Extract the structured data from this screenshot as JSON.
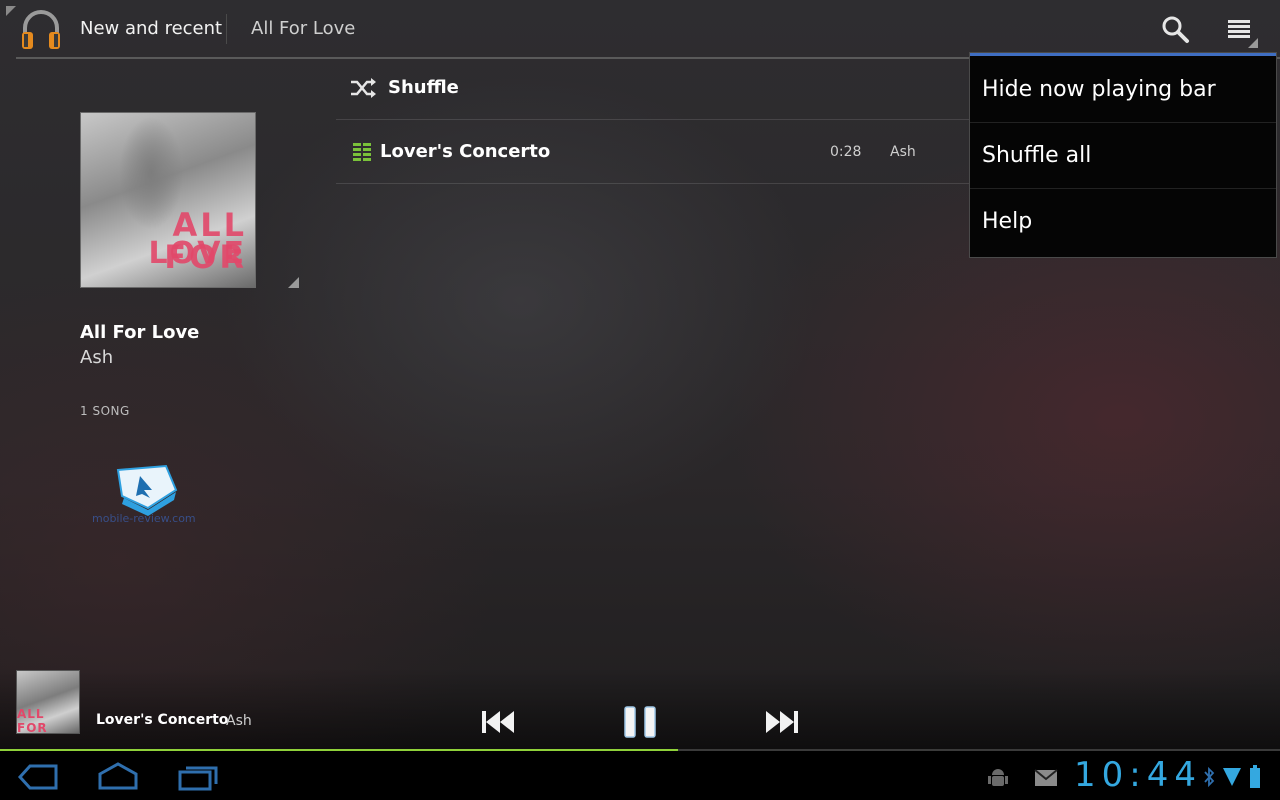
{
  "action_bar": {
    "tab_new_recent": "New and recent",
    "tab_album": "All For Love"
  },
  "album": {
    "title": "All For Love",
    "artist": "Ash",
    "song_count": "1 SONG",
    "art_text_line1": "ALL FOR",
    "art_text_line2": "LOVE"
  },
  "watermark": {
    "text": "mobile-review.com"
  },
  "list": {
    "shuffle_label": "Shuffle",
    "tracks": [
      {
        "title": "Lover's Concerto",
        "duration": "0:28",
        "artist": "Ash"
      }
    ]
  },
  "overflow_menu": {
    "items": [
      {
        "label": "Hide now playing bar"
      },
      {
        "label": "Shuffle all"
      },
      {
        "label": "Help"
      }
    ]
  },
  "now_playing": {
    "title": "Lover's Concerto",
    "artist": "Ash",
    "progress": 0.53,
    "art_text": "ALL FOR LOVE"
  },
  "system_bar": {
    "clock": "10:44"
  },
  "colors": {
    "accent_blue": "#34a8e0",
    "progress_green": "#8fd13a",
    "menu_accent": "#3f6ec2",
    "album_art_pink": "#e2486a"
  },
  "icons": [
    "headphones-logo",
    "search-icon",
    "overflow-menu-icon",
    "shuffle-icon",
    "equalizer-icon",
    "previous-icon",
    "pause-icon",
    "next-icon",
    "back-icon",
    "home-icon",
    "recent-apps-icon",
    "usb-debug-icon",
    "mail-icon",
    "bluetooth-icon",
    "signal-icon",
    "battery-icon"
  ]
}
